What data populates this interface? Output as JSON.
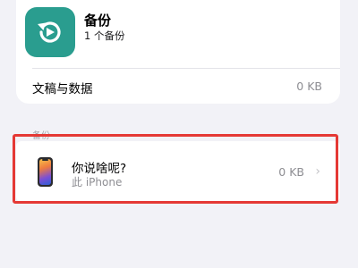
{
  "backup_card": {
    "title": "备份",
    "subtitle": "1 个备份",
    "docs_label": "文稿与数据",
    "docs_value": "0 KB"
  },
  "section": {
    "header": "备份"
  },
  "device": {
    "name": "你说啥呢?",
    "model": "此 iPhone",
    "size": "0 KB",
    "chevron": "›"
  },
  "icons": {
    "app": "backup-icon",
    "device": "iphone-icon",
    "chevron": "chevron-right-icon"
  },
  "colors": {
    "app_icon": "#2a9d8f",
    "highlight": "#e53935",
    "background": "#f2f2f7"
  }
}
